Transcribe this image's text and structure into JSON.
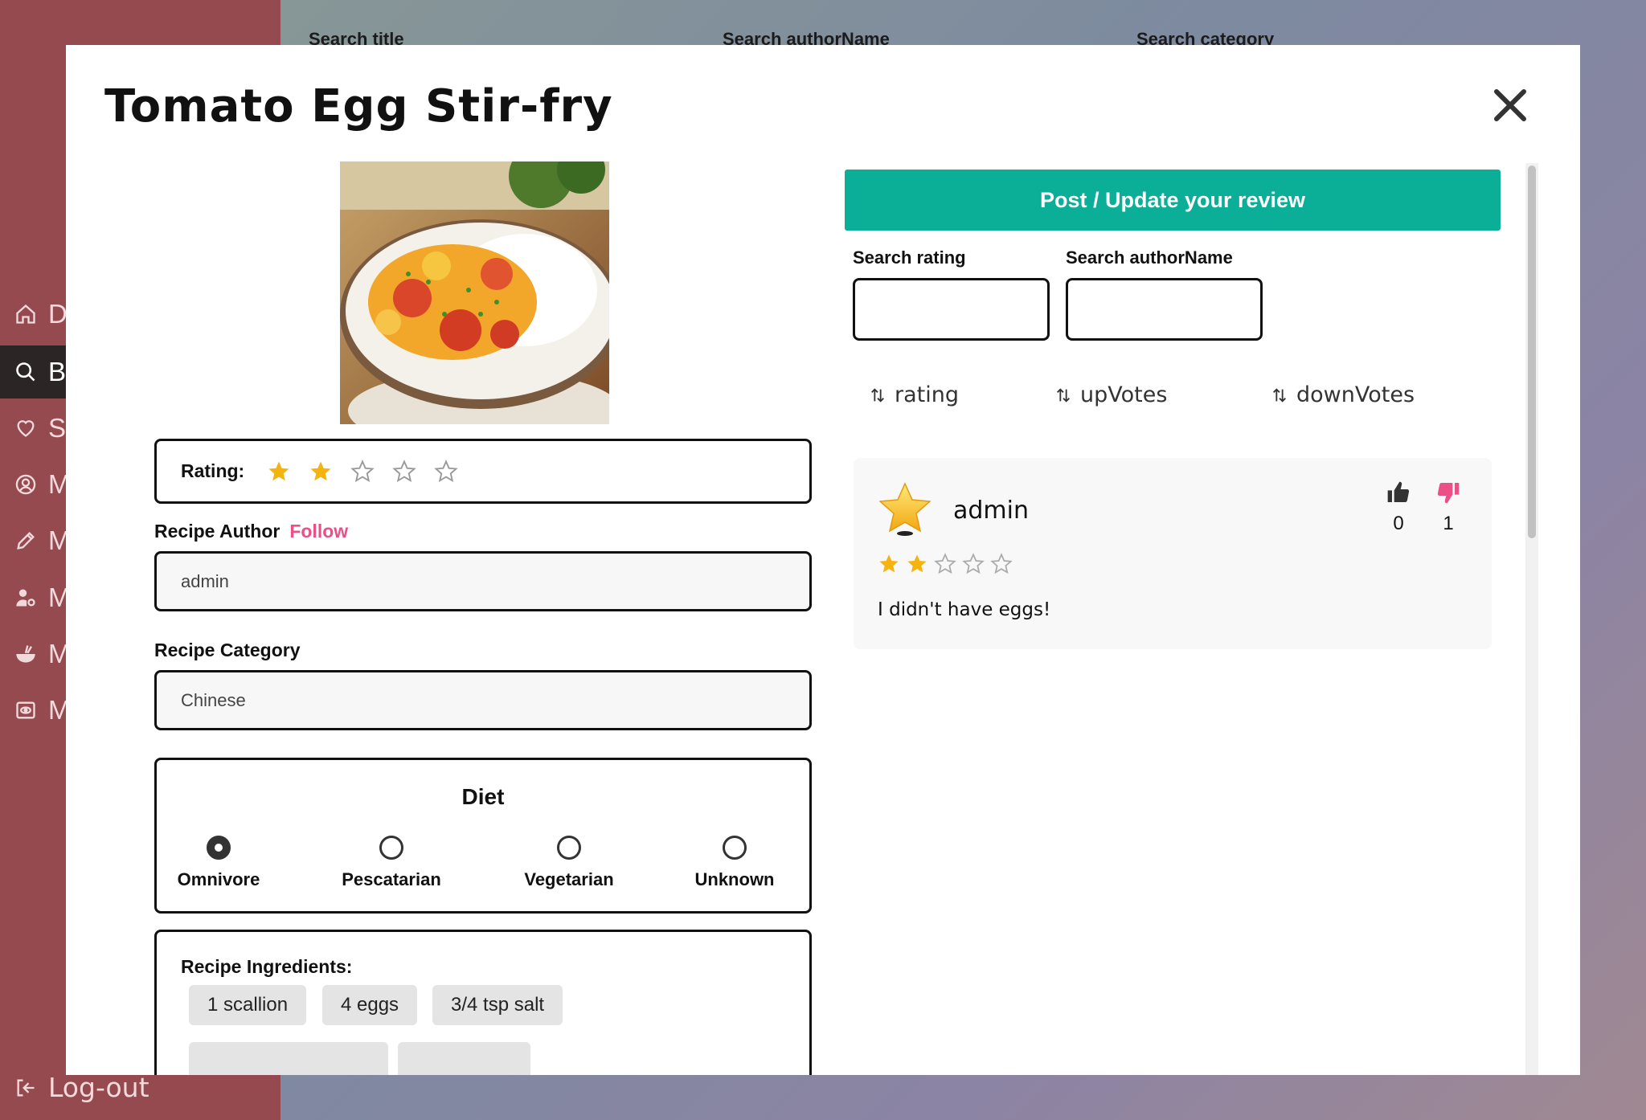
{
  "sidebar": {
    "items": [
      {
        "label": "Do",
        "icon": "home-icon"
      },
      {
        "label": "Br",
        "icon": "search-icon",
        "active": true
      },
      {
        "label": "Sa",
        "icon": "heart-icon"
      },
      {
        "label": "M",
        "icon": "user-circle-icon"
      },
      {
        "label": "M",
        "icon": "pencil-icon"
      },
      {
        "label": "M",
        "icon": "user-gear-icon"
      },
      {
        "label": "M",
        "icon": "bowl-icon"
      },
      {
        "label": "M",
        "icon": "eye-icon"
      }
    ],
    "logout_label": "Log-out"
  },
  "background": {
    "search_title": "Search title",
    "search_author": "Search authorName",
    "search_category": "Search category"
  },
  "modal": {
    "title": "Tomato Egg Stir-fry",
    "rating_label": "Rating:",
    "rating_value": 2,
    "rating_max": 5,
    "author_label": "Recipe Author",
    "follow_label": "Follow",
    "author_value": "admin",
    "category_label": "Recipe Category",
    "category_value": "Chinese",
    "diet": {
      "title": "Diet",
      "options": [
        "Omnivore",
        "Pescatarian",
        "Vegetarian",
        "Unknown"
      ],
      "selected": "Omnivore"
    },
    "ingredients": {
      "title": "Recipe Ingredients:",
      "items": [
        "1 scallion",
        "4 eggs",
        "3/4 tsp salt"
      ]
    }
  },
  "reviews": {
    "post_button": "Post / Update your review",
    "search_rating_label": "Search rating",
    "search_author_label": "Search authorName",
    "sort": {
      "rating": "rating",
      "upvotes": "upVotes",
      "downvotes": "downVotes"
    },
    "items": [
      {
        "author": "admin",
        "rating": 2,
        "text": "I didn't have eggs!",
        "upvotes": "0",
        "downvotes": "1"
      }
    ]
  },
  "colors": {
    "sidebar": "#944a4f",
    "accent_teal": "#0bae96",
    "follow_pink": "#ea4f86",
    "star_gold": "#f5b30f"
  }
}
